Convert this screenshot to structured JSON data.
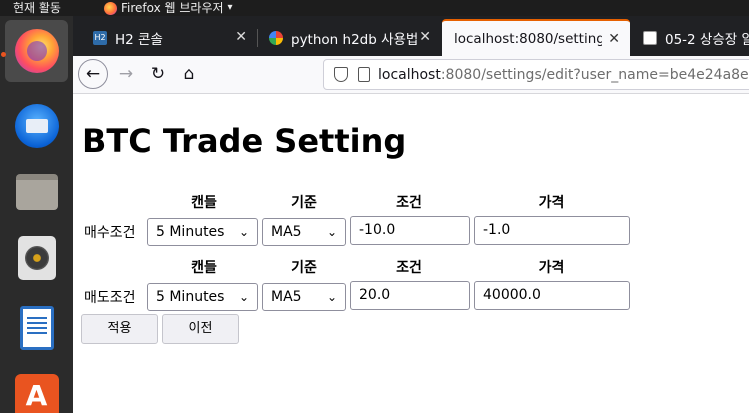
{
  "topbar": {
    "activities": "현재 활동",
    "app_name": "Firefox 웹 브라우저",
    "app_caret": "▾"
  },
  "dock": {
    "items": [
      "firefox",
      "thunderbird",
      "files",
      "rhythmbox",
      "writer",
      "software"
    ]
  },
  "tabs": [
    {
      "label": "H2 콘솔",
      "close": "✕"
    },
    {
      "label": "python h2db 사용법",
      "close": "✕"
    },
    {
      "label": "localhost:8080/setting",
      "close": "✕"
    },
    {
      "label": "05-2 상승장 알",
      "close": ""
    }
  ],
  "nav": {
    "back": "←",
    "forward": "→",
    "reload": "↻",
    "home": "⌂",
    "url_host": "localhost",
    "url_rest": ":8080/settings/edit?user_name=be4e24a8e"
  },
  "page": {
    "title": "BTC Trade Setting",
    "headers": {
      "candle": "캔들",
      "basis": "기준",
      "condition": "조건",
      "price": "가격"
    },
    "buy": {
      "label": "매수조건",
      "candle": "5 Minutes",
      "basis": "MA5",
      "condition": "-10.0",
      "price": "-1.0"
    },
    "sell": {
      "label": "매도조건",
      "candle": "5 Minutes",
      "basis": "MA5",
      "condition": "20.0",
      "price": "40000.0"
    },
    "apply_button": "적용",
    "prev_button": "이전",
    "chevron": "⌄"
  }
}
